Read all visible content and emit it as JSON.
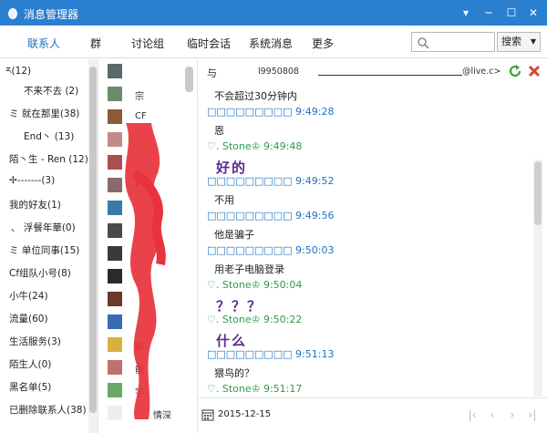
{
  "window": {
    "title": "消息管理器"
  },
  "tabs": [
    "联系人",
    "群",
    "讨论组",
    "临时会话",
    "系统消息",
    "更多"
  ],
  "search": {
    "placeholder": "",
    "button_label": "搜索"
  },
  "groups": [
    "ར(12)",
    "不来不去 (2)",
    "ミ 就在那里(38)",
    "End丶 (13)",
    "陌丶生 - Ren (12)",
    "✢-------(3)",
    "我的好友(1)",
    "、 浮餐年華(0)",
    "ミ 单位同事(15)",
    "Cf组队小号(8)",
    "小牛(24)",
    "流量(60)",
    "生活服务(3)",
    "陌生人(0)",
    "黑名单(5)",
    "已删除联系人(38)"
  ],
  "contacts": [
    {
      "name": "",
      "avatar_color": "#5a6a6a"
    },
    {
      "name": "宗",
      "avatar_color": "#6b8c6b"
    },
    {
      "name": "CF",
      "avatar_color": "#8a5a3a"
    },
    {
      "name": "",
      "avatar_color": "#c48a8a"
    },
    {
      "name": "",
      "avatar_color": "#a85050"
    },
    {
      "name": "k",
      "avatar_color": "#8a6a6a"
    },
    {
      "name": "",
      "avatar_color": "#3a7aa8"
    },
    {
      "name": "",
      "avatar_color": "#4a4a4a"
    },
    {
      "name": "",
      "avatar_color": "#3a3a3a"
    },
    {
      "name": "",
      "avatar_color": "#2a2a2a"
    },
    {
      "name": "",
      "avatar_color": "#6a3a2a"
    },
    {
      "name": "",
      "avatar_color": "#3a6ab0"
    },
    {
      "name": "能",
      "avatar_color": "#d8b040"
    },
    {
      "name": "能",
      "avatar_color": "#c07070"
    },
    {
      "name": "字",
      "avatar_color": "#6aa86a"
    },
    {
      "name": "情深",
      "avatar_color": "#eeeeee"
    }
  ],
  "chat": {
    "with_label": "与",
    "peer_id": "l9950808",
    "peer_domain": "@live.c>",
    "messages": [
      {
        "kind": "body",
        "text": "不会超过30分钟内"
      },
      {
        "kind": "hdr-me",
        "text": "□□□□□□□□□ 9:49:28"
      },
      {
        "kind": "body",
        "text": "恩"
      },
      {
        "kind": "hdr-peer",
        "text": "♡. Stone♔ 9:49:48"
      },
      {
        "kind": "big",
        "text": "好的"
      },
      {
        "kind": "hdr-me",
        "text": "□□□□□□□□□ 9:49:52"
      },
      {
        "kind": "body",
        "text": "不用"
      },
      {
        "kind": "hdr-me",
        "text": "□□□□□□□□□ 9:49:56"
      },
      {
        "kind": "body",
        "text": "他是骗子"
      },
      {
        "kind": "hdr-me",
        "text": "□□□□□□□□□ 9:50:03"
      },
      {
        "kind": "body",
        "text": "用老子电脑登录"
      },
      {
        "kind": "hdr-peer",
        "text": "♡. Stone♔ 9:50:04"
      },
      {
        "kind": "big",
        "text": "？？？"
      },
      {
        "kind": "hdr-peer",
        "text": "♡. Stone♔ 9:50:22"
      },
      {
        "kind": "big",
        "text": "什么"
      },
      {
        "kind": "hdr-me",
        "text": "□□□□□□□□□ 9:51:13"
      },
      {
        "kind": "body",
        "text": "猥鸟的？"
      },
      {
        "kind": "hdr-peer",
        "text": "♡. Stone♔ 9:51:17"
      }
    ]
  },
  "footer": {
    "date": "2015-12-15"
  },
  "colors": {
    "titlebar": "#2b7fd0",
    "accent": "#1a6fc0",
    "peer_name": "#2f9a52",
    "emphasis": "#5a2a8a"
  }
}
